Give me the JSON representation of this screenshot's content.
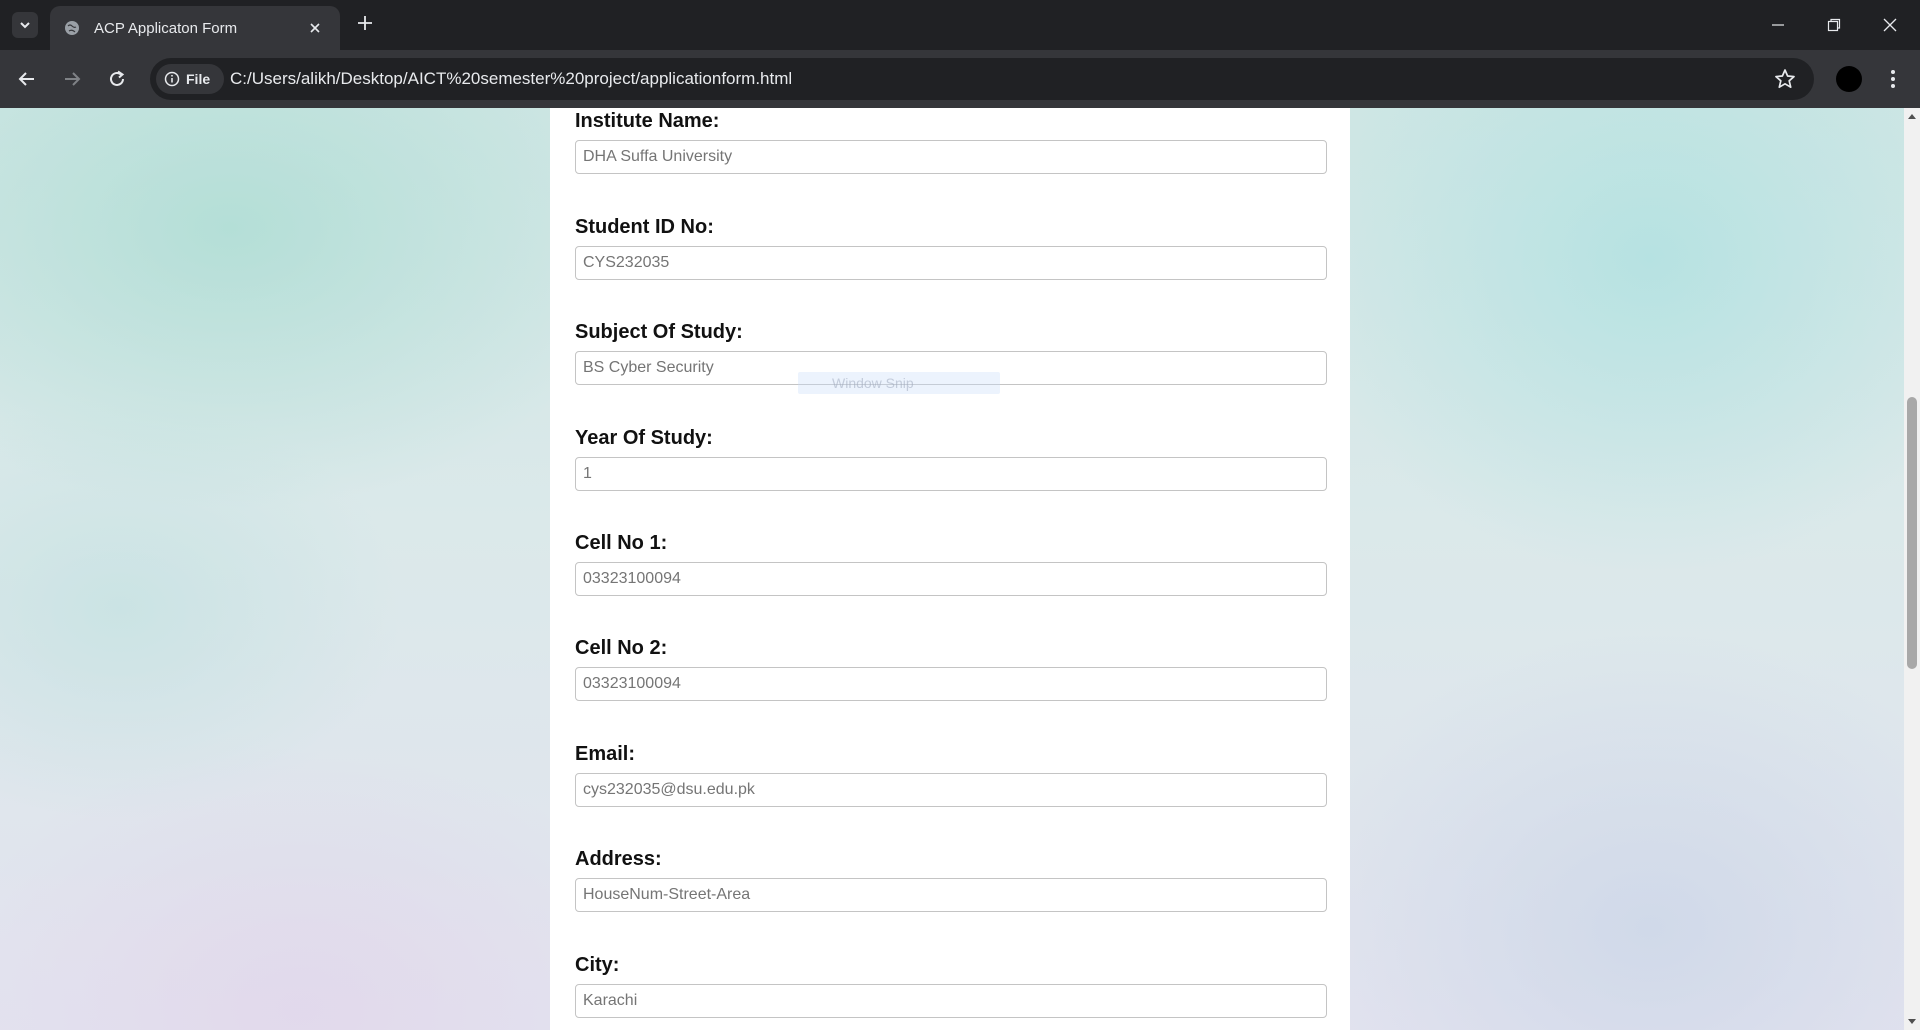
{
  "browser": {
    "tab_title": "ACP Applicaton Form",
    "site_chip_label": "File",
    "url": "C:/Users/alikh/Desktop/AICT%20semester%20project/applicationform.html"
  },
  "form": {
    "fields": [
      {
        "label": "Institute Name:",
        "placeholder": "DHA Suffa University"
      },
      {
        "label": "Student ID No:",
        "placeholder": "CYS232035"
      },
      {
        "label": "Subject Of Study:",
        "placeholder": "BS Cyber Security"
      },
      {
        "label": "Year Of Study:",
        "placeholder": "1"
      },
      {
        "label": "Cell No 1:",
        "placeholder": "03323100094"
      },
      {
        "label": "Cell No 2:",
        "placeholder": "03323100094"
      },
      {
        "label": "Email:",
        "placeholder": "cys232035@dsu.edu.pk"
      },
      {
        "label": "Address:",
        "placeholder": "HouseNum-Street-Area"
      },
      {
        "label": "City:",
        "placeholder": "Karachi"
      }
    ]
  },
  "overlay": {
    "snip_text": "Window Snip"
  },
  "colors": {
    "chrome_dark": "#202124",
    "chrome_toolbar": "#35363a",
    "card_background": "#ffffff",
    "input_border": "#c4c4c4"
  }
}
